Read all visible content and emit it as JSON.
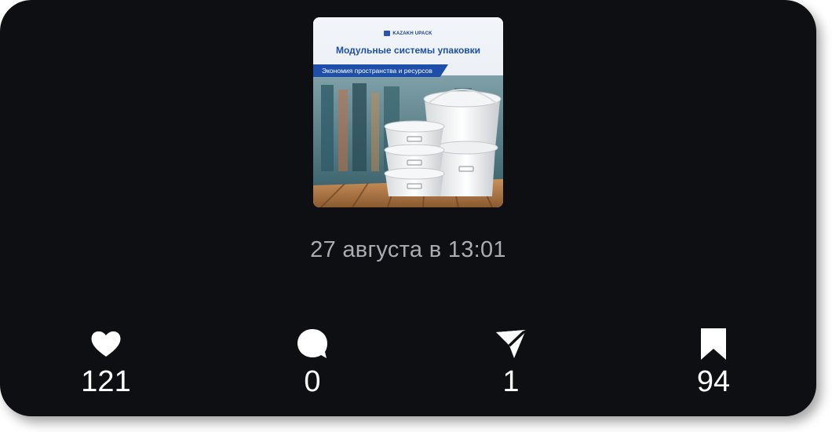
{
  "post": {
    "image": {
      "brand": "KAZAKH UPACK",
      "title": "Модульные системы упаковки",
      "subtitle": "Экономия пространства и ресурсов"
    },
    "timestamp": "27 августа в 13:01"
  },
  "stats": {
    "likes": "121",
    "comments": "0",
    "shares": "1",
    "saves": "94"
  },
  "colors": {
    "background": "#0d0f12",
    "timestamp": "#a9acb1",
    "icons": "#ffffff"
  }
}
